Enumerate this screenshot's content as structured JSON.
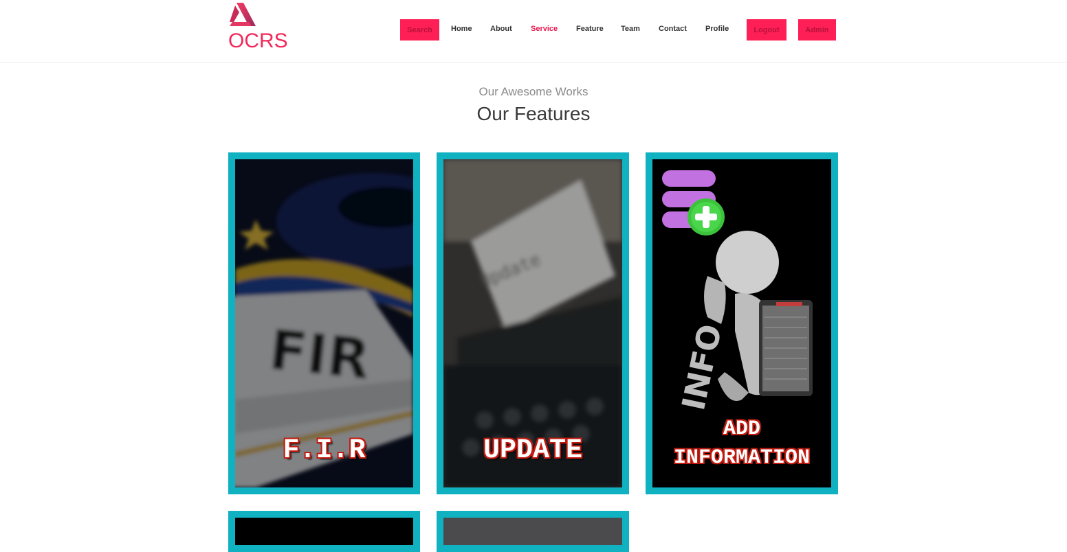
{
  "brand": {
    "name": "OCRS"
  },
  "nav": {
    "search": "Search",
    "home": "Home",
    "about": "About",
    "service": "Service",
    "feature": "Feature",
    "team": "Team",
    "contact": "Contact",
    "profile": "Profile",
    "logout": "Logout",
    "admin": "Admin",
    "active": "Service"
  },
  "section": {
    "subtitle": "Our Awesome Works",
    "title": "Our Features"
  },
  "cards": [
    {
      "caption": "F.I.R",
      "image_text": "FIR"
    },
    {
      "caption": "UPDATE",
      "image_text": "Update"
    },
    {
      "caption_line1": "ADD",
      "caption_line2": "INFORMATION",
      "image_text": "INFO"
    }
  ],
  "colors": {
    "accent": "#fd1f55",
    "card_border": "#10b2c2",
    "caption_outline": "#c21b10"
  }
}
